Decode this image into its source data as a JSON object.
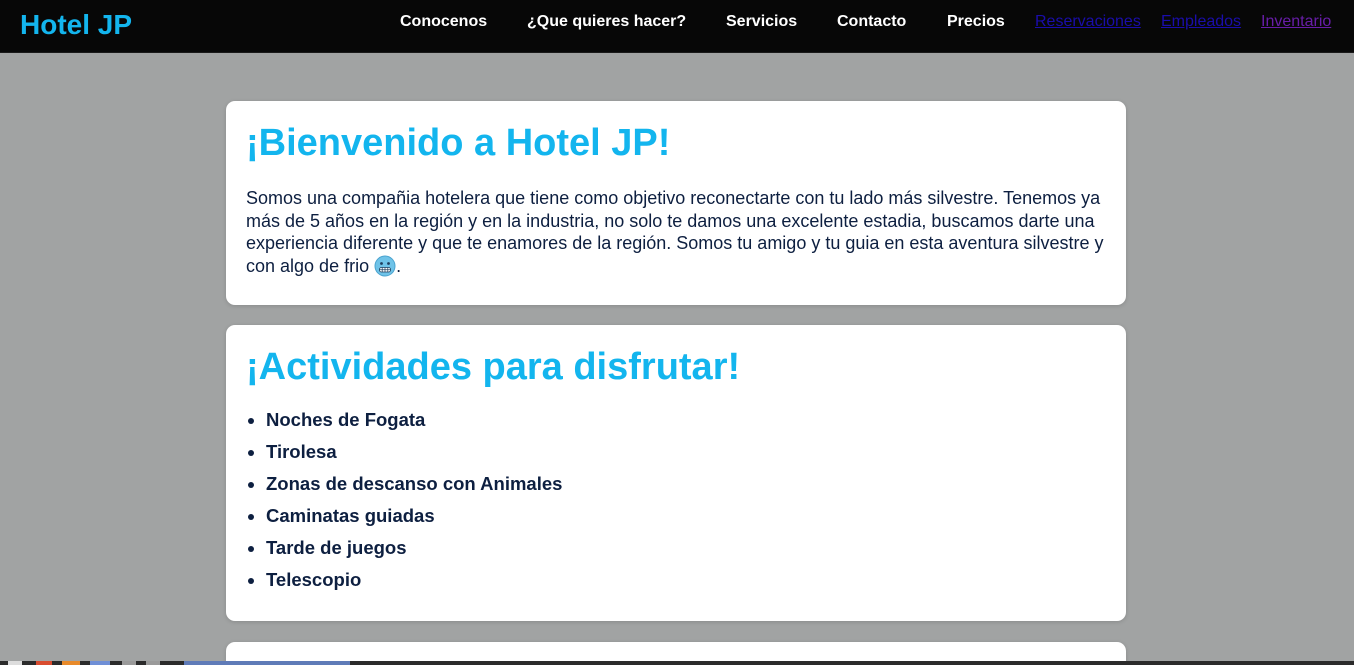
{
  "navbar": {
    "brand": "Hotel JP",
    "links": [
      {
        "label": "Conocenos"
      },
      {
        "label": "¿Que quieres hacer?"
      },
      {
        "label": "Servicios"
      },
      {
        "label": "Contacto"
      },
      {
        "label": "Precios"
      }
    ],
    "anchors": [
      {
        "label": "Reservaciones",
        "color": "#1a0dab"
      },
      {
        "label": "Empleados",
        "color": "#1a0dab"
      },
      {
        "label": "Inventario",
        "color": "#681da8"
      }
    ]
  },
  "welcome": {
    "title": "¡Bienvenido a Hotel JP!",
    "body": "Somos una compañia hotelera que tiene como objetivo reconectarte con tu lado más silvestre. Tenemos ya más de 5 años en la región y en la industria, no solo te damos una excelente estadia, buscamos darte una experiencia diferente y que te enamores de la región. Somos tu amigo y tu guia en esta aventura silvestre y con algo de frio",
    "emoji": "cold-face-icon",
    "end_punct": "."
  },
  "activities": {
    "title": "¡Actividades para disfrutar!",
    "items": [
      "Noches de Fogata",
      "Tirolesa",
      "Zonas de descanso con Animales",
      "Caminatas guiadas",
      "Tarde de juegos",
      "Telescopio"
    ]
  },
  "colors": {
    "accent": "#13b5ee",
    "navbar_bg": "#070707",
    "page_bg": "#a1a3a3",
    "text": "#0d1f40"
  }
}
